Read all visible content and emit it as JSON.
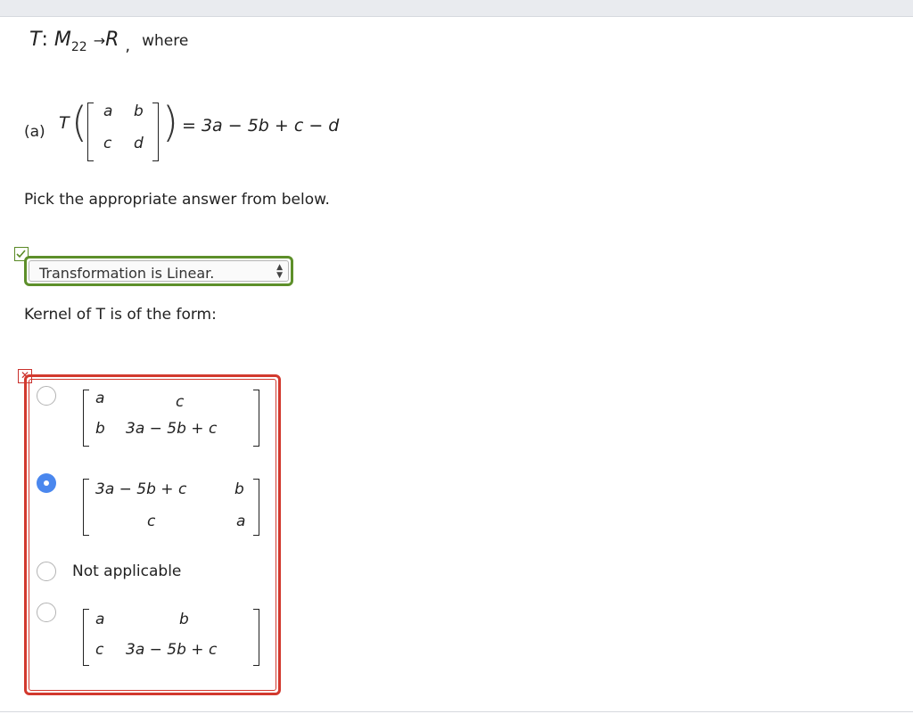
{
  "heading": {
    "t": "T",
    "colon": ":",
    "m": "M",
    "sub": "22",
    "arrow": "→",
    "r": "R",
    "comma": ",",
    "where": "where"
  },
  "part_a": {
    "label": "(a)",
    "t": "T",
    "matrix": [
      "a",
      "b",
      "c",
      "d"
    ],
    "rhs": "= 3a − 5b + c − d"
  },
  "prompt": "Pick the appropriate answer from below.",
  "linearity_select": {
    "value": "Transformation is Linear.",
    "status": "correct",
    "status_icon": "check-icon",
    "accent": "#5d8f2a"
  },
  "kernel_label": "Kernel of T is of the form:",
  "kernel_question": {
    "status": "incorrect",
    "status_icon": "x-icon",
    "accent": "#d2392e",
    "options": [
      {
        "selected": false,
        "matrix": [
          [
            "a",
            "c"
          ],
          [
            "b",
            "3a − 5b + c"
          ]
        ]
      },
      {
        "selected": true,
        "matrix": [
          [
            "3a − 5b + c",
            "b"
          ],
          [
            "c",
            "a"
          ]
        ]
      },
      {
        "selected": false,
        "text": "Not applicable"
      },
      {
        "selected": false,
        "matrix": [
          [
            "a",
            "b"
          ],
          [
            "c",
            "3a − 5b + c"
          ]
        ]
      }
    ]
  }
}
